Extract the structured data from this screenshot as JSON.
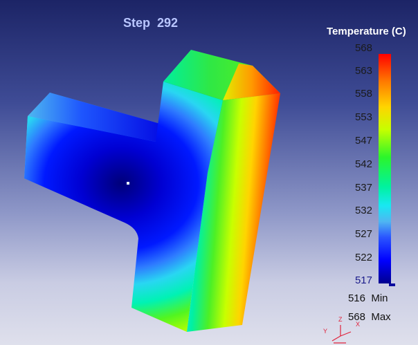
{
  "viewport": {
    "title_prefix": "Step",
    "step_number": "292"
  },
  "legend": {
    "title": "Temperature (C)",
    "ticks": [
      "568",
      "563",
      "558",
      "553",
      "547",
      "542",
      "537",
      "532",
      "527",
      "522",
      "517"
    ],
    "min_label": "Min",
    "min_value": "516",
    "max_label": "Max",
    "max_value": "568",
    "colors": {
      "max": "#ff0000",
      "mid": "#2bf52b",
      "min": "#00008f"
    }
  },
  "triad": {
    "x_label": "X",
    "y_label": "Y",
    "z_label": "Z",
    "color": "#e0203a"
  },
  "model": {
    "probe_marker_color": "#e8ffff"
  }
}
